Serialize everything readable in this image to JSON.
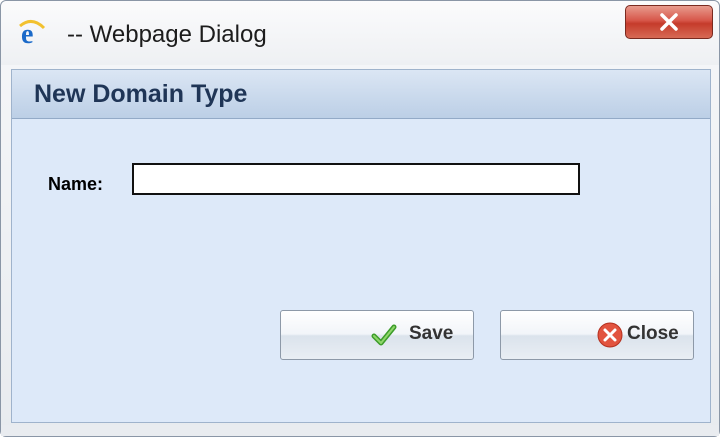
{
  "window": {
    "title": "-- Webpage Dialog",
    "icon": "internet-explorer-icon",
    "close_icon": "close-x-icon"
  },
  "dialog": {
    "header_title": "New Domain Type",
    "name_label": "Name:",
    "name_value": ""
  },
  "buttons": {
    "save_label": "Save",
    "save_icon": "checkmark-icon",
    "close_label": "Close",
    "close_icon": "red-x-circle-icon"
  },
  "colors": {
    "client_bg": "#dde9f9",
    "header_text": "#1f3556",
    "titlebar_close": "#c53b2b"
  }
}
